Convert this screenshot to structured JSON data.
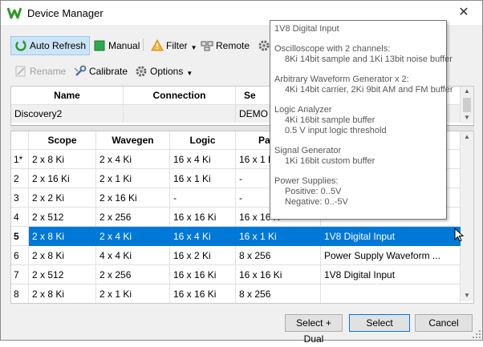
{
  "window": {
    "title": "Device Manager",
    "close_glyph": "✕"
  },
  "toolbar1": {
    "auto_refresh": "Auto Refresh",
    "manual": "Manual",
    "filter": "Filter",
    "remote": "Remote"
  },
  "toolbar2": {
    "rename": "Rename",
    "calibrate": "Calibrate",
    "options": "Options"
  },
  "device_table": {
    "headers": [
      "Name",
      "Connection",
      "Se"
    ],
    "row": [
      "Discovery2",
      "",
      "DEMO"
    ]
  },
  "config_table": {
    "headers": [
      "",
      "Scope",
      "Wavegen",
      "Logic",
      "Pa"
    ],
    "rows": [
      {
        "num": "1*",
        "cells": [
          "2 x 8 Ki",
          "2 x 4 Ki",
          "16 x 4 Ki",
          "16 x 1 Ki",
          ""
        ]
      },
      {
        "num": "2",
        "cells": [
          "2 x 16 Ki",
          "2 x 1 Ki",
          "16 x 1 Ki",
          "-",
          ""
        ]
      },
      {
        "num": "3",
        "cells": [
          "2 x 2 Ki",
          "2 x 16 Ki",
          "-",
          "-",
          ""
        ]
      },
      {
        "num": "4",
        "cells": [
          "2 x 512",
          "2 x 256",
          "16 x 16 Ki",
          "16 x 16 K",
          ""
        ]
      },
      {
        "num": "5",
        "cells": [
          "2 x 8 Ki",
          "2 x 4 Ki",
          "16 x 4 Ki",
          "16 x 1 Ki",
          "1V8 Digital Input"
        ],
        "selected": true
      },
      {
        "num": "6",
        "cells": [
          "2 x 8 Ki",
          "4 x 4 Ki",
          "16 x 2 Ki",
          "8 x 256",
          "Power Supply Waveform ..."
        ]
      },
      {
        "num": "7",
        "cells": [
          "2 x 512",
          "2 x 256",
          "16 x 16 Ki",
          "16 x 16 Ki",
          "1V8 Digital Input"
        ]
      },
      {
        "num": "8",
        "cells": [
          "2 x 8 Ki",
          "2 x 1 Ki",
          "16 x 16 Ki",
          "8 x 256",
          ""
        ]
      }
    ]
  },
  "tooltip": {
    "lines": [
      "1V8 Digital Input",
      "Oscilloscope with 2 channels:",
      "8Ki 14bit sample and 1Ki 13bit noise buffer",
      "Arbitrary Waveform Generator x 2:",
      "4Ki 14bit carrier, 2Ki 9bit AM and FM buffer",
      "Logic Analyzer",
      "4Ki 16bit sample buffer",
      "0.5 V input logic threshold",
      "Signal Generator",
      "1Ki 16bit custom buffer",
      "Power Supplies:",
      "Positive: 0..5V",
      "Negative: 0..-5V"
    ]
  },
  "buttons": {
    "select_dual": "Select + Dual",
    "select": "Select",
    "cancel": "Cancel"
  },
  "colors": {
    "selection": "#0078d7",
    "toolbar_active": "#cce4f7"
  }
}
